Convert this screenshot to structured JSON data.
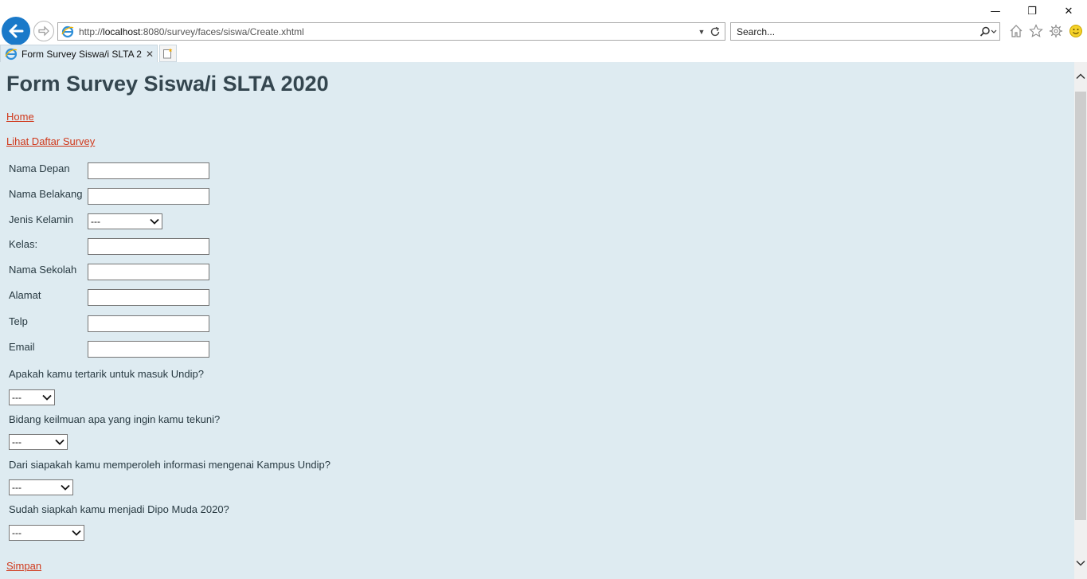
{
  "browser": {
    "url_prefix": "http://",
    "url_host": "localhost",
    "url_path": ":8080/survey/faces/siswa/Create.xhtml",
    "search_placeholder": "Search...",
    "tab_title": "Form Survey Siswa/i SLTA 2...",
    "tab_close": "✕",
    "win_minimize": "—",
    "win_restore": "❐",
    "win_close": "✕",
    "accent": "#1a79c9"
  },
  "page": {
    "title": "Form Survey Siswa/i SLTA 2020",
    "links": {
      "home": "Home",
      "list": "Lihat Daftar Survey",
      "save": "Simpan"
    },
    "fields": {
      "nama_depan": {
        "label": "Nama Depan",
        "value": ""
      },
      "nama_belakang": {
        "label": "Nama Belakang",
        "value": ""
      },
      "jenis_kelamin": {
        "label": "Jenis Kelamin",
        "selected": "---"
      },
      "kelas": {
        "label": "Kelas:",
        "value": ""
      },
      "nama_sekolah": {
        "label": "Nama Sekolah",
        "value": ""
      },
      "alamat": {
        "label": "Alamat",
        "value": ""
      },
      "telp": {
        "label": "Telp",
        "value": ""
      },
      "email": {
        "label": "Email",
        "value": ""
      }
    },
    "questions": [
      {
        "text": "Apakah kamu tertarik untuk masuk Undip?",
        "selected": "---"
      },
      {
        "text": "Bidang keilmuan apa yang ingin kamu tekuni?",
        "selected": "---"
      },
      {
        "text": "Dari siapakah kamu memperoleh informasi mengenai Kampus Undip?",
        "selected": "---"
      },
      {
        "text": "Sudah siapkah kamu menjadi Dipo Muda 2020?",
        "selected": "---"
      }
    ],
    "colors": {
      "background": "#deebf1",
      "link": "#d0381b",
      "title": "#34464f"
    }
  }
}
